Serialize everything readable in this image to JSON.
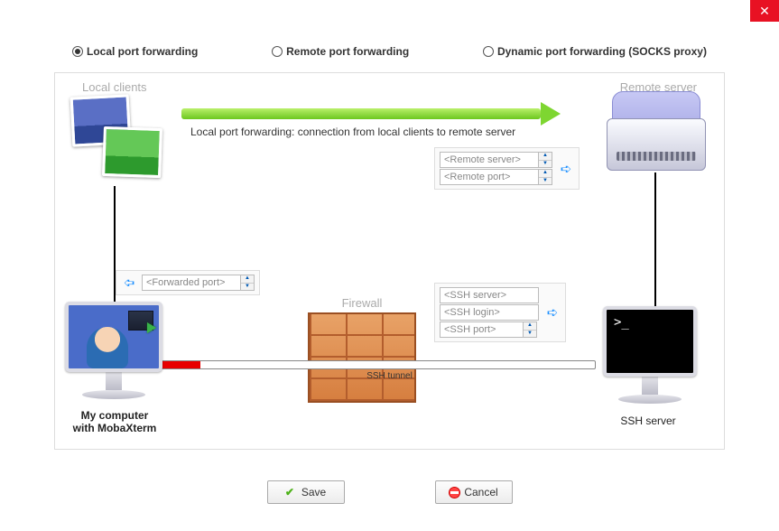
{
  "close": "✕",
  "radios": {
    "local": "Local port forwarding",
    "remote": "Remote port forwarding",
    "dynamic": "Dynamic port forwarding (SOCKS proxy)"
  },
  "labels": {
    "local_clients": "Local clients",
    "remote_server": "Remote server",
    "firewall": "Firewall",
    "ssh_tunnel": "SSH tunnel",
    "arrow_caption": "Local port forwarding: connection from local clients to remote server",
    "my_computer_line1": "My computer",
    "my_computer_line2": "with MobaXterm",
    "ssh_server_caption": "SSH server"
  },
  "fields": {
    "forwarded_port": "<Forwarded port>",
    "remote_server": "<Remote server>",
    "remote_port": "<Remote port>",
    "ssh_server": "<SSH server>",
    "ssh_login": "<SSH login>",
    "ssh_port": "<SSH port>"
  },
  "buttons": {
    "save": "Save",
    "cancel": "Cancel"
  },
  "terminal_prompt": ">_"
}
